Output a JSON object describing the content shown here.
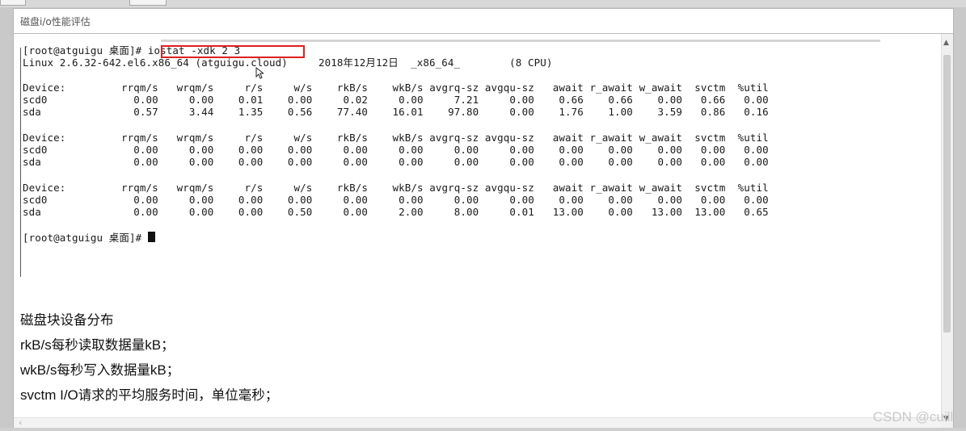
{
  "window": {
    "title": "磁盘i/o性能评估"
  },
  "terminal": {
    "prompt": "[root@atguigu 桌面]# ",
    "command": "iostat -xdk 2 3",
    "sysinfo": "Linux 2.6.32-642.el6.x86_64 (atguigu.cloud)     2018年12月12日  _x86_64_        (8 CPU)",
    "header": "Device:         rrqm/s   wrqm/s     r/s     w/s    rkB/s    wkB/s avgrq-sz avgqu-sz   await r_await w_await  svctm  %util",
    "blocks": [
      [
        "scd0              0.00     0.00    0.01    0.00     0.02     0.00     7.21     0.00    0.66    0.66    0.00   0.66   0.00",
        "sda               0.57     3.44    1.35    0.56    77.40    16.01    97.80     0.00    1.76    1.00    3.59   0.86   0.16"
      ],
      [
        "scd0              0.00     0.00    0.00    0.00     0.00     0.00     0.00     0.00    0.00    0.00    0.00   0.00   0.00",
        "sda               0.00     0.00    0.00    0.00     0.00     0.00     0.00     0.00    0.00    0.00    0.00   0.00   0.00"
      ],
      [
        "scd0              0.00     0.00    0.00    0.00     0.00     0.00     0.00     0.00    0.00    0.00    0.00   0.00   0.00",
        "sda               0.00     0.00    0.00    0.50     0.00     2.00     8.00     0.01   13.00    0.00   13.00  13.00   0.65"
      ]
    ],
    "final_prompt": "[root@atguigu 桌面]# "
  },
  "notes": [
    {
      "en": "",
      "cn": "磁盘块设备分布"
    },
    {
      "en": "rkB/s",
      "cn": "每秒读取数据量",
      "en2": "kB",
      "tail": "；"
    },
    {
      "en": "wkB/s",
      "cn": "每秒写入数据量",
      "en2": "kB",
      "tail": "；"
    },
    {
      "en": "svctm I/O",
      "cn": "请求的平均服务时间，单位毫秒；",
      "en2": "",
      "tail": ""
    }
  ],
  "watermark": "CSDN @cuilll",
  "colors": {
    "highlight_border": "#e02020",
    "watermark": "#c8c8c8"
  },
  "icons": {
    "scroll_up": "chevron-up-icon",
    "scroll_down": "chevron-down-icon",
    "scroll_left": "chevron-left-icon",
    "mouse": "text-cursor-icon"
  }
}
